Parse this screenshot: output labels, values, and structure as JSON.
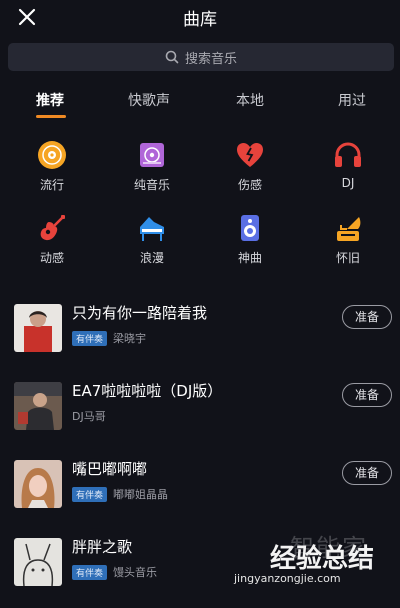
{
  "header": {
    "title": "曲库"
  },
  "search": {
    "placeholder": "搜索音乐"
  },
  "tabs": [
    {
      "label": "推荐"
    },
    {
      "label": "快歌声"
    },
    {
      "label": "本地"
    },
    {
      "label": "用过"
    }
  ],
  "categories": [
    {
      "label": "流行",
      "icon": "vinyl-record-icon",
      "color": "#f6a524"
    },
    {
      "label": "纯音乐",
      "icon": "music-album-icon",
      "color": "#b066d8"
    },
    {
      "label": "伤感",
      "icon": "broken-heart-icon",
      "color": "#e7433c"
    },
    {
      "label": "DJ",
      "icon": "headphones-icon",
      "color": "#e7433c"
    },
    {
      "label": "动感",
      "icon": "guitar-icon",
      "color": "#e7433c"
    },
    {
      "label": "浪漫",
      "icon": "piano-icon",
      "color": "#2f8ee8"
    },
    {
      "label": "神曲",
      "icon": "speaker-icon",
      "color": "#5a6fe4"
    },
    {
      "label": "怀旧",
      "icon": "gramophone-icon",
      "color": "#f6a524"
    }
  ],
  "songs": [
    {
      "title": "只为有你一路陪着我",
      "badge": "有伴奏",
      "artist": "梁晓宇",
      "button": "准备"
    },
    {
      "title": "EA7啦啦啦啦（DJ版）",
      "badge": "",
      "artist": "DJ马哥",
      "button": "准备"
    },
    {
      "title": "嘴巴嘟啊嘟",
      "badge": "有伴奏",
      "artist": "嘟嘟姐晶晶",
      "button": "准备"
    },
    {
      "title": "胖胖之歌",
      "badge": "有伴奏",
      "artist": "馒头音乐",
      "button": ""
    }
  ],
  "watermark": {
    "line1": "智能家",
    "line2": "经验总结",
    "line3": "jingyanzongjie.com"
  },
  "colors": {
    "accent": "#f08a24",
    "background": "#111219",
    "badge": "#2f6fb8"
  }
}
